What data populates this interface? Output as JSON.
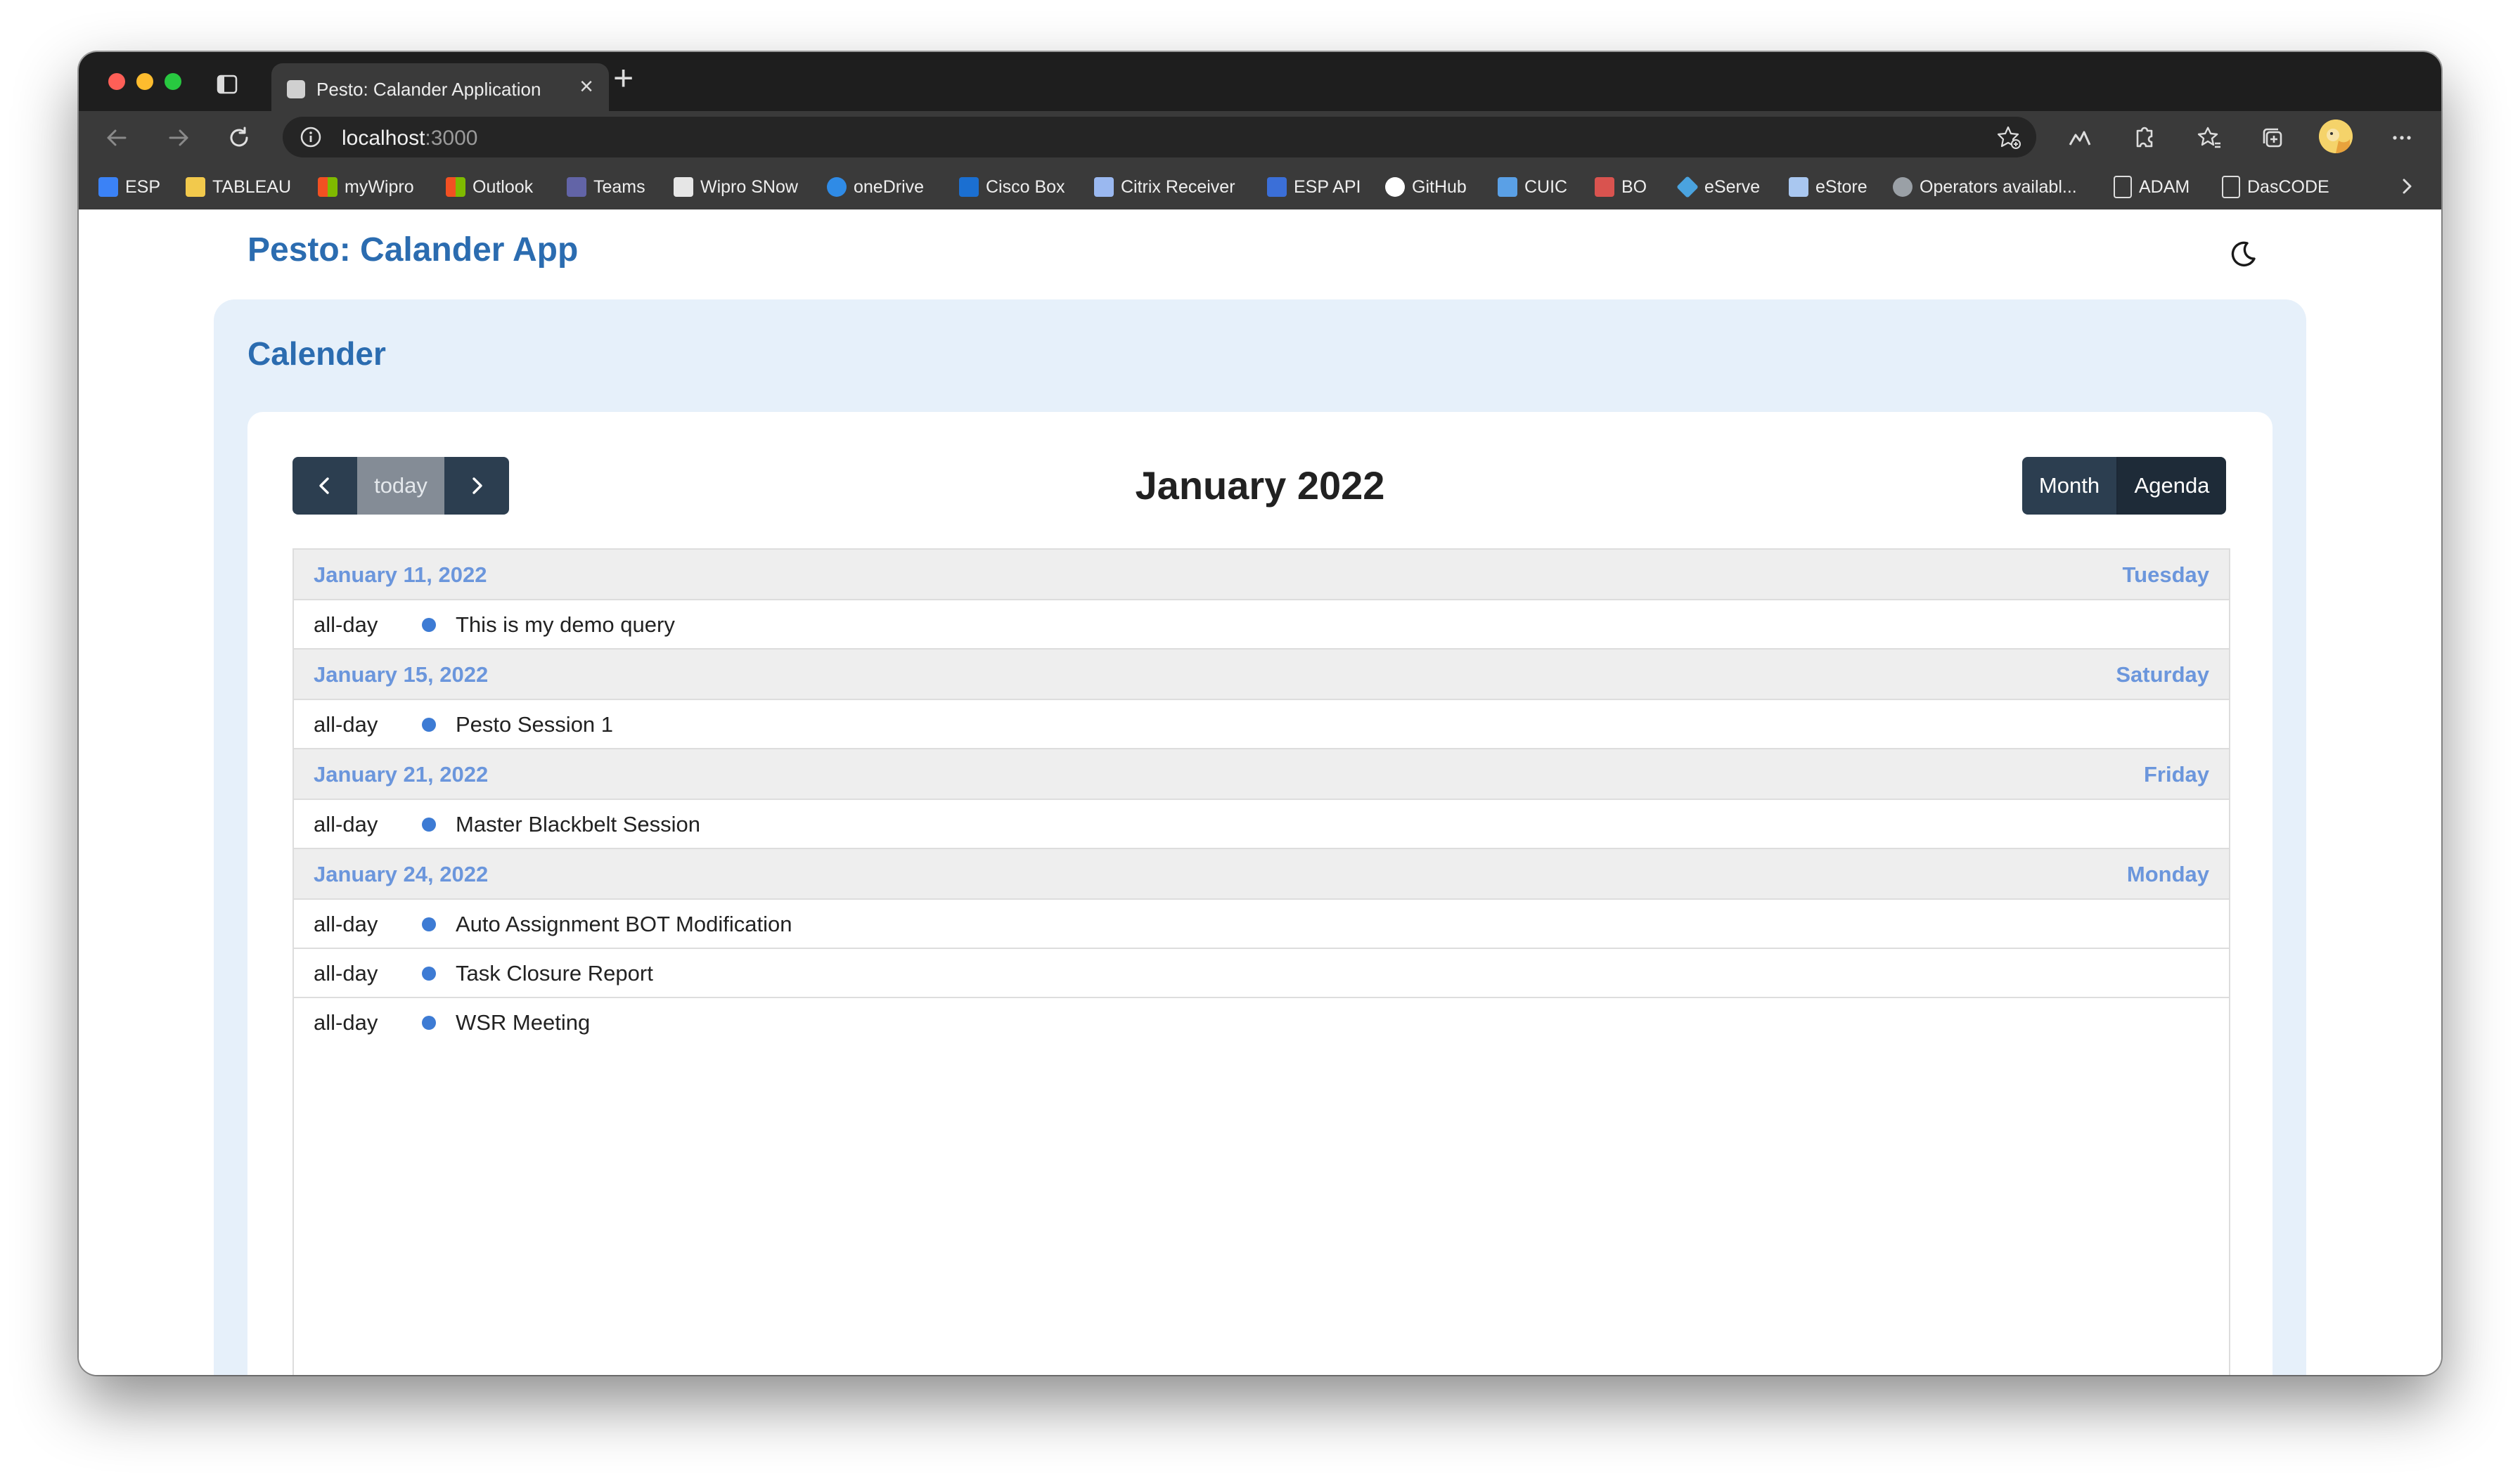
{
  "browser": {
    "tab_title": "Pesto: Calander Application",
    "url_host": "localhost",
    "url_port": ":3000",
    "bookmarks": [
      {
        "label": "ESP",
        "icon": "esp-icon",
        "color": "#3b82f6"
      },
      {
        "label": "TABLEAU",
        "icon": "folder-icon",
        "color": "#f2c94c"
      },
      {
        "label": "myWipro",
        "icon": "microsoft-icon",
        "color": "#f25022"
      },
      {
        "label": "Outlook",
        "icon": "microsoft-icon",
        "color": "#f25022"
      },
      {
        "label": "Teams",
        "icon": "teams-icon",
        "color": "#6264a7"
      },
      {
        "label": "Wipro SNow",
        "icon": "snow-icon",
        "color": "#e6e6e6"
      },
      {
        "label": "oneDrive",
        "icon": "cloud-icon",
        "color": "#2f8be6"
      },
      {
        "label": "Cisco Box",
        "icon": "box-icon",
        "color": "#1b6fd1"
      },
      {
        "label": "Citrix Receiver",
        "icon": "lock-icon",
        "color": "#9ab8f0"
      },
      {
        "label": "ESP API",
        "icon": "shield-icon",
        "color": "#3b6fd8"
      },
      {
        "label": "GitHub",
        "icon": "github-icon",
        "color": "#ffffff"
      },
      {
        "label": "CUIC",
        "icon": "chart-icon",
        "color": "#5aa0e6"
      },
      {
        "label": "BO",
        "icon": "bo-icon",
        "color": "#d9534f"
      },
      {
        "label": "eServe",
        "icon": "diamond-icon",
        "color": "#4aa3df"
      },
      {
        "label": "eStore",
        "icon": "store-icon",
        "color": "#a9c7f0"
      },
      {
        "label": "Operators availabl...",
        "icon": "circle-icon",
        "color": "#9aa0a6"
      },
      {
        "label": "ADAM",
        "icon": "page-icon",
        "color": "#dddddd"
      },
      {
        "label": "DasCODE",
        "icon": "page-icon",
        "color": "#dddddd"
      }
    ]
  },
  "app": {
    "title": "Pesto: Calander App",
    "panel_title": "Calender"
  },
  "calendar": {
    "title": "January 2022",
    "today_label": "today",
    "views": {
      "month": "Month",
      "agenda": "Agenda"
    },
    "days": [
      {
        "date": "January 11, 2022",
        "weekday": "Tuesday",
        "events": [
          {
            "time": "all-day",
            "title": "This is my demo query"
          }
        ]
      },
      {
        "date": "January 15, 2022",
        "weekday": "Saturday",
        "events": [
          {
            "time": "all-day",
            "title": "Pesto Session 1"
          }
        ]
      },
      {
        "date": "January 21, 2022",
        "weekday": "Friday",
        "events": [
          {
            "time": "all-day",
            "title": "Master Blackbelt Session"
          }
        ]
      },
      {
        "date": "January 24, 2022",
        "weekday": "Monday",
        "events": [
          {
            "time": "all-day",
            "title": "Auto Assignment BOT Modification"
          },
          {
            "time": "all-day",
            "title": "Task Closure Report"
          },
          {
            "time": "all-day",
            "title": "WSR Meeting"
          }
        ]
      }
    ]
  },
  "colors": {
    "accent": "#2b6cb0",
    "date_header": "#6b96dc",
    "event_dot": "#3d7bd4",
    "toolbar_button": "#2c3e50"
  }
}
